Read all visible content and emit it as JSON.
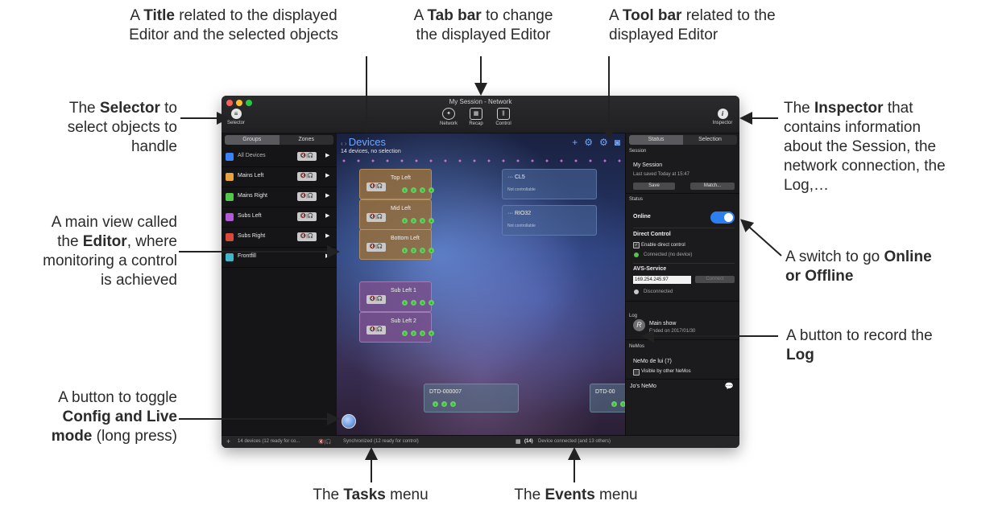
{
  "annotations": {
    "title": {
      "pre": "A ",
      "bold": "Title",
      "post": " related to the displayed",
      "line2": "Editor and the selected objects"
    },
    "tabbar": {
      "pre": "A ",
      "bold": "Tab bar",
      "post": " to change",
      "line2": "the displayed Editor"
    },
    "toolbar": {
      "pre": "A ",
      "bold": "Tool bar",
      "post": " related to the",
      "line2": "displayed Editor"
    },
    "selector": {
      "pre": "The ",
      "bold": "Selector",
      "post": " to",
      "line2": "select objects to",
      "line3": "handle"
    },
    "editor": {
      "line1": "A main view called",
      "pre": "the ",
      "bold": "Editor",
      "post": ", where",
      "line3": "monitoring a control",
      "line4": "is achieved"
    },
    "mode": {
      "line1": "A button to toggle",
      "bold": "Config and Live",
      "bold2": "mode",
      "post": " (long press)"
    },
    "inspector": {
      "pre": "The ",
      "bold": "Inspector",
      "post": " that",
      "line2": "contains information",
      "line3": "about the Session, the",
      "line4": "network connection, the",
      "line5": "Log,…"
    },
    "online": {
      "pre": "A switch to go ",
      "bold": "Online",
      "bold2": "or Offline"
    },
    "log": {
      "line1": "A button to record the",
      "bold": "Log"
    },
    "tasks": {
      "pre": "The ",
      "bold": "Tasks",
      "post": " menu"
    },
    "events": {
      "pre": "The ",
      "bold": "Events",
      "post": " menu"
    }
  },
  "window": {
    "title": "My Session - Network",
    "selector_label": "Selector",
    "inspector_label": "Inspector",
    "tabs": [
      {
        "label": "Network",
        "icon": "network-icon"
      },
      {
        "label": "Recap",
        "icon": "recap-icon"
      },
      {
        "label": "Control",
        "icon": "control-icon"
      }
    ]
  },
  "selector": {
    "tabs": [
      "Groups",
      "Zones"
    ],
    "groups": [
      {
        "name": "All Devices",
        "color": "#3b82f6"
      },
      {
        "name": "Mains Left",
        "color": "#e8a33c"
      },
      {
        "name": "Mains Right",
        "color": "#52c74a"
      },
      {
        "name": "Subs Left",
        "color": "#b25ad8"
      },
      {
        "name": "Subs Right",
        "color": "#d9483b"
      },
      {
        "name": "Frontfill",
        "color": "#3fb7c9"
      }
    ]
  },
  "editor": {
    "title": "Devices",
    "subtitle": "14 devices, no selection",
    "amp_cards": [
      "Top Left",
      "Mid Left",
      "Bottom Left",
      "Sub Left 1",
      "Sub Left 2"
    ],
    "remote_cards": [
      {
        "name": "CL5",
        "status": "Not controllable"
      },
      {
        "name": "RIO32",
        "status": "Not controllable"
      }
    ],
    "dtd_cards": [
      "DTD-000007",
      "DTD-00"
    ]
  },
  "inspector": {
    "tabs": [
      "Status",
      "Selection"
    ],
    "session_header": "Session",
    "session_name": "My Session",
    "session_saved": "Last saved Today at 15:47",
    "save_label": "Save",
    "match_label": "Match...",
    "status_header": "Status",
    "online_label": "Online",
    "direct_control_label": "Direct Control",
    "enable_direct_control": "Enable direct control",
    "connected_text": "Connected (no device)",
    "avs_label": "AVS-Service",
    "avs_ip": "169.254.245.97",
    "connect_label": "Connect",
    "disconnected_text": "Disconnected",
    "log_header": "Log",
    "log_icon_letter": "R",
    "log_name": "Main show",
    "log_date": "Ended on 2017/01/30",
    "nemos_header": "NeMos",
    "nemo_name": "NeMo de lui (7)",
    "visible_label": "Visible by other NeMos",
    "jos_nemo": "Jo's NeMo"
  },
  "statusbar": {
    "device_count": "14 devices (12 ready for co...",
    "tasks_text": "Synchronized (12 ready for control)",
    "events_count": "(14)",
    "events_text": "Device connected (and 13 others)"
  }
}
